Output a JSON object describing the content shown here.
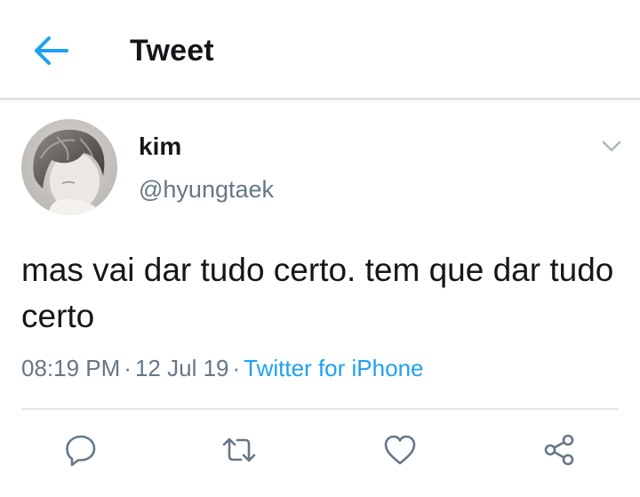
{
  "header": {
    "title": "Tweet",
    "back_icon": "arrow-left-icon"
  },
  "tweet": {
    "author": {
      "name": "kim",
      "handle": "@hyungtaek",
      "avatar": "avatar-photo"
    },
    "text": "mas vai dar tudo certo. tem que dar tudo certo",
    "meta": {
      "time": "08:19 PM",
      "separator": "·",
      "date": "12 Jul 19",
      "source": "Twitter for iPhone"
    }
  },
  "actions": [
    {
      "name": "reply",
      "icon": "reply-icon"
    },
    {
      "name": "retweet",
      "icon": "retweet-icon"
    },
    {
      "name": "like",
      "icon": "heart-icon"
    },
    {
      "name": "share",
      "icon": "share-icon"
    }
  ],
  "colors": {
    "accent": "#1da1f2",
    "text_primary": "#14171a",
    "text_secondary": "#657786",
    "divider": "#e1e8ed"
  }
}
